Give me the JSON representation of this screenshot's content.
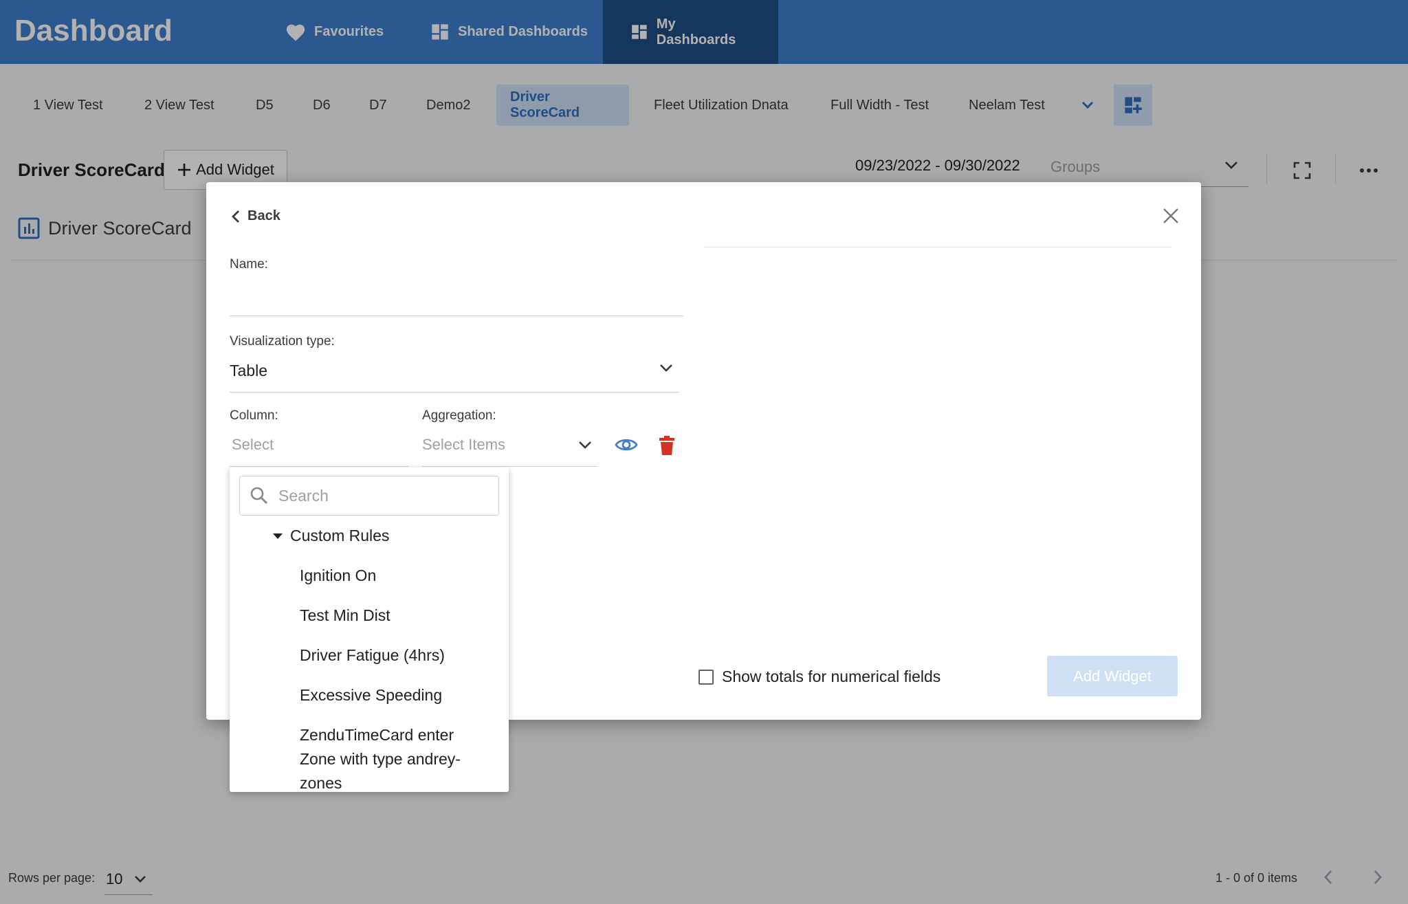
{
  "app": {
    "title": "Dashboard"
  },
  "top_nav": [
    {
      "label": "Favourites",
      "icon": "heart-icon"
    },
    {
      "label": "Shared Dashboards",
      "icon": "dashboard-icon"
    },
    {
      "label": "My Dashboards",
      "icon": "dashboard-icon",
      "active": true
    }
  ],
  "dashboard_tabs": [
    {
      "label": "1 View Test"
    },
    {
      "label": "2 View Test"
    },
    {
      "label": "D5"
    },
    {
      "label": "D6"
    },
    {
      "label": "D7"
    },
    {
      "label": "Demo2"
    },
    {
      "label": "Driver ScoreCard",
      "active": true
    },
    {
      "label": "Fleet Utilization Dnata"
    },
    {
      "label": "Full Width - Test"
    },
    {
      "label": "Neelam Test"
    }
  ],
  "header": {
    "title": "Driver ScoreCard",
    "add_widget_label": "Add Widget",
    "date_range": "09/23/2022 - 09/30/2022",
    "groups_placeholder": "Groups"
  },
  "widget": {
    "title": "Driver ScoreCard"
  },
  "footer": {
    "rows_per_page_label": "Rows per page:",
    "rows_per_page_value": "10",
    "pager_text": "1 - 0 of 0 items"
  },
  "modal": {
    "back_label": "Back",
    "name_label": "Name:",
    "name_value": "",
    "visualization_label": "Visualization type:",
    "visualization_value": "Table",
    "column_label": "Column:",
    "column_placeholder": "Select",
    "aggregation_label": "Aggregation:",
    "aggregation_placeholder": "Select Items",
    "show_totals_label": "Show totals for numerical fields",
    "show_totals_checked": false,
    "add_widget_label": "Add Widget"
  },
  "column_dropdown": {
    "search_placeholder": "Search",
    "group_label": "Custom Rules",
    "items": [
      "Ignition On",
      "Test Min Dist",
      "Driver Fatigue (4hrs)",
      "Excessive Speeding",
      "ZenduTimeCard enter Zone with type andrey-zones"
    ]
  },
  "colors": {
    "brand_blue": "#3f7fce",
    "active_nav": "#1f4f86",
    "active_tab_bg": "#cfe0f5",
    "danger_red": "#d93025"
  }
}
